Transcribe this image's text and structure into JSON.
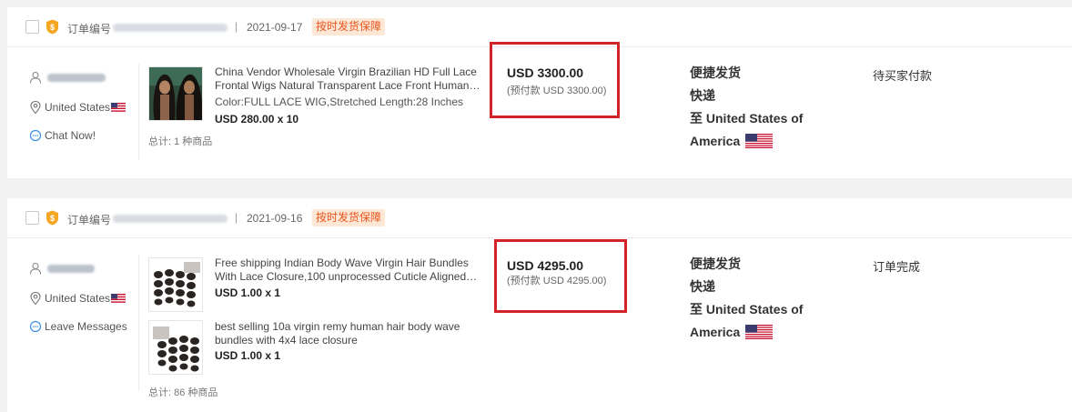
{
  "orders": [
    {
      "order_label": "订单编号",
      "separator": "|",
      "date": "2021-09-17",
      "tag": "按时发货保障",
      "buyer": {
        "country": "United States",
        "contact": "Chat Now!"
      },
      "products": [
        {
          "title_line1": "China Vendor Wholesale Virgin Brazilian HD Full Lace",
          "title_line2": "Frontal Wigs Natural Transparent Lace Front Human…",
          "spec": "Color:FULL LACE WIG,Stretched Length:28 Inches",
          "price": "USD 280.00 x 10"
        }
      ],
      "total": "总计: 1 种商品",
      "amount": "USD 3300.00",
      "prepay": "(预付款 USD 3300.00)",
      "shipping": {
        "method": "便捷发货",
        "carrier": "快递",
        "dest_line1": "至 United States of",
        "dest_line2": "America"
      },
      "status": "待买家付款"
    },
    {
      "order_label": "订单编号",
      "separator": "|",
      "date": "2021-09-16",
      "tag": "按时发货保障",
      "buyer": {
        "country": "United States",
        "contact": "Leave Messages"
      },
      "products": [
        {
          "title_line1": "Free shipping Indian Body Wave Virgin Hair Bundles",
          "title_line2": "With Lace Closure,100 unprocessed Cuticle Aligned…",
          "price": "USD 1.00 x 1"
        },
        {
          "title_line1": "best selling 10a virgin remy human hair body wave",
          "title_line2": "bundles with 4x4 lace closure",
          "price": "USD 1.00 x 1"
        }
      ],
      "total": "总计: 86 种商品",
      "amount": "USD 4295.00",
      "prepay": "(预付款 USD 4295.00)",
      "shipping": {
        "method": "便捷发货",
        "carrier": "快递",
        "dest_line1": "至 United States of",
        "dest_line2": "America"
      },
      "status": "订单完成"
    }
  ],
  "colors": {
    "highlight_box": "#d2232a",
    "tag_text": "#e8541e",
    "tag_bg": "#fde8d6",
    "badge": "#f5a623"
  },
  "icons": [
    "user-icon",
    "location-pin-icon",
    "chat-icon",
    "message-icon",
    "us-flag-icon",
    "guarantee-badge-icon"
  ]
}
